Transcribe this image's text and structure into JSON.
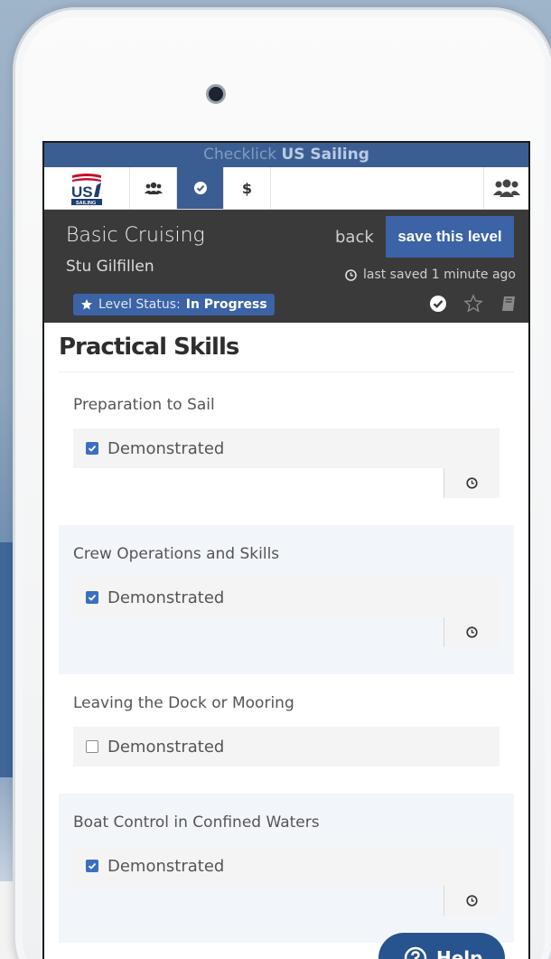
{
  "topbar": {
    "brand_light": "Checklick",
    "brand_bold": "US Sailing"
  },
  "navbar": {
    "logo_text": "US",
    "logo_subtext": "SAILING",
    "tabs": [
      {
        "icon": "users-icon",
        "active": false
      },
      {
        "icon": "check-circle-icon",
        "active": true
      },
      {
        "label": "$",
        "icon": "dollar-icon",
        "active": false
      }
    ],
    "right_icon": "group-icon"
  },
  "header": {
    "course_title": "Basic Cruising",
    "student_name": "Stu Gilfillen",
    "back_label": "back",
    "save_label": "save this level",
    "last_saved": "last saved 1 minute ago",
    "level_status_label": "Level Status:",
    "level_status_value": "In Progress",
    "icons": [
      "check-circle-icon",
      "star-outline-icon",
      "book-icon"
    ]
  },
  "section": {
    "title": "Practical Skills"
  },
  "skills": [
    {
      "name": "Preparation to Sail",
      "demo_label": "Demonstrated",
      "checked": true
    },
    {
      "name": "Crew Operations and Skills",
      "demo_label": "Demonstrated",
      "checked": true
    },
    {
      "name": "Leaving the Dock or Mooring",
      "demo_label": "Demonstrated",
      "checked": false
    },
    {
      "name": "Boat Control in Confined Waters",
      "demo_label": "Demonstrated",
      "checked": true
    }
  ],
  "help": {
    "label": "Help"
  },
  "colors": {
    "accent": "#3b63a5",
    "topbar": "#3b5e92",
    "header_bg": "#3a3a3a"
  }
}
